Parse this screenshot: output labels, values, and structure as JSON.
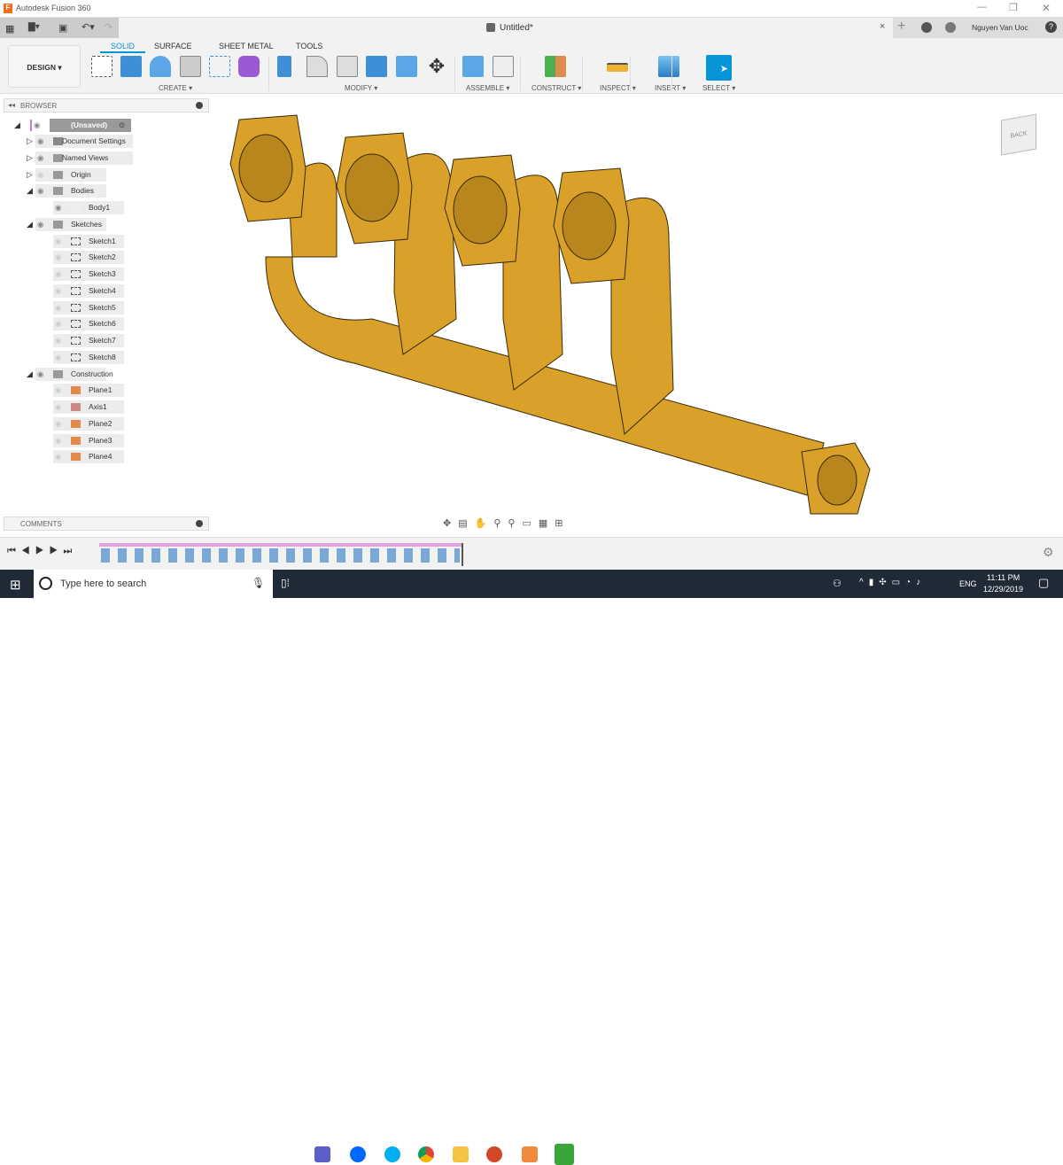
{
  "window": {
    "title": "Autodesk Fusion 360",
    "doc_title": "Untitled*",
    "user": "Nguyen Van Uoc"
  },
  "toolbar": {
    "workspace": "DESIGN ▾",
    "tabs": [
      "SOLID",
      "SURFACE",
      "SHEET METAL",
      "TOOLS"
    ],
    "active_tab": "SOLID",
    "groups": [
      "CREATE ▾",
      "MODIFY ▾",
      "ASSEMBLE ▾",
      "CONSTRUCT ▾",
      "INSPECT ▾",
      "INSERT ▾",
      "SELECT ▾"
    ]
  },
  "browser": {
    "title": "BROWSER",
    "root": "(Unsaved)",
    "items": [
      "Document Settings",
      "Named Views",
      "Origin",
      "Bodies",
      "Body1",
      "Sketches",
      "Sketch1",
      "Sketch2",
      "Sketch3",
      "Sketch4",
      "Sketch5",
      "Sketch6",
      "Sketch7",
      "Sketch8",
      "Construction",
      "Plane1",
      "Axis1",
      "Plane2",
      "Plane3",
      "Plane4"
    ]
  },
  "comments": {
    "title": "COMMENTS"
  },
  "viewcube": {
    "face": "BACK"
  },
  "model_color": "#d9a12a",
  "accent": "#0696d7",
  "taskbar": {
    "search_placeholder": "Type here to search",
    "lang": "ENG",
    "time": "11:11 PM",
    "date": "12/29/2019"
  }
}
